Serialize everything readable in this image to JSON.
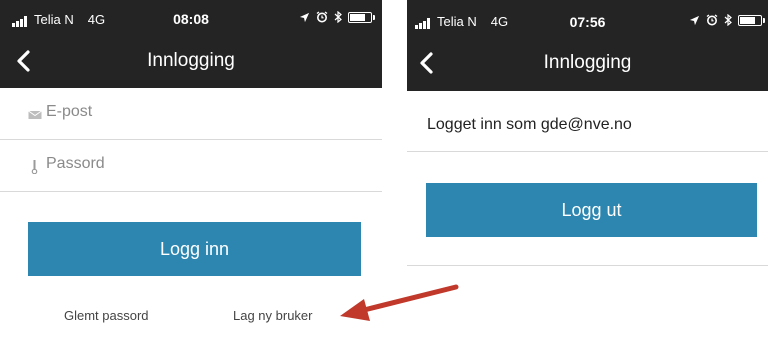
{
  "colors": {
    "appbar": "#242424",
    "primary": "#2c86b0",
    "arrow": "#c0392b"
  },
  "left": {
    "status": {
      "carrier": "Telia N",
      "network": "4G",
      "time": "08:08"
    },
    "title": "Innlogging",
    "email_label": "E-post",
    "password_label": "Passord",
    "login_button": "Logg inn",
    "forgot_password": "Glemt passord",
    "create_user": "Lag ny bruker"
  },
  "right": {
    "status": {
      "carrier": "Telia N",
      "network": "4G",
      "time": "07:56"
    },
    "title": "Innlogging",
    "logged_in_text": "Logget inn som gde@nve.no",
    "logout_button": "Logg ut"
  },
  "icons": {
    "back": "chevron-left-icon",
    "email": "envelope-icon",
    "password": "key-icon",
    "location": "location-arrow-icon",
    "alarm": "alarm-clock-icon",
    "bluetooth": "bluetooth-icon",
    "battery": "battery-icon",
    "signal": "signal-bars-icon",
    "annotation": "red-arrow-icon"
  }
}
